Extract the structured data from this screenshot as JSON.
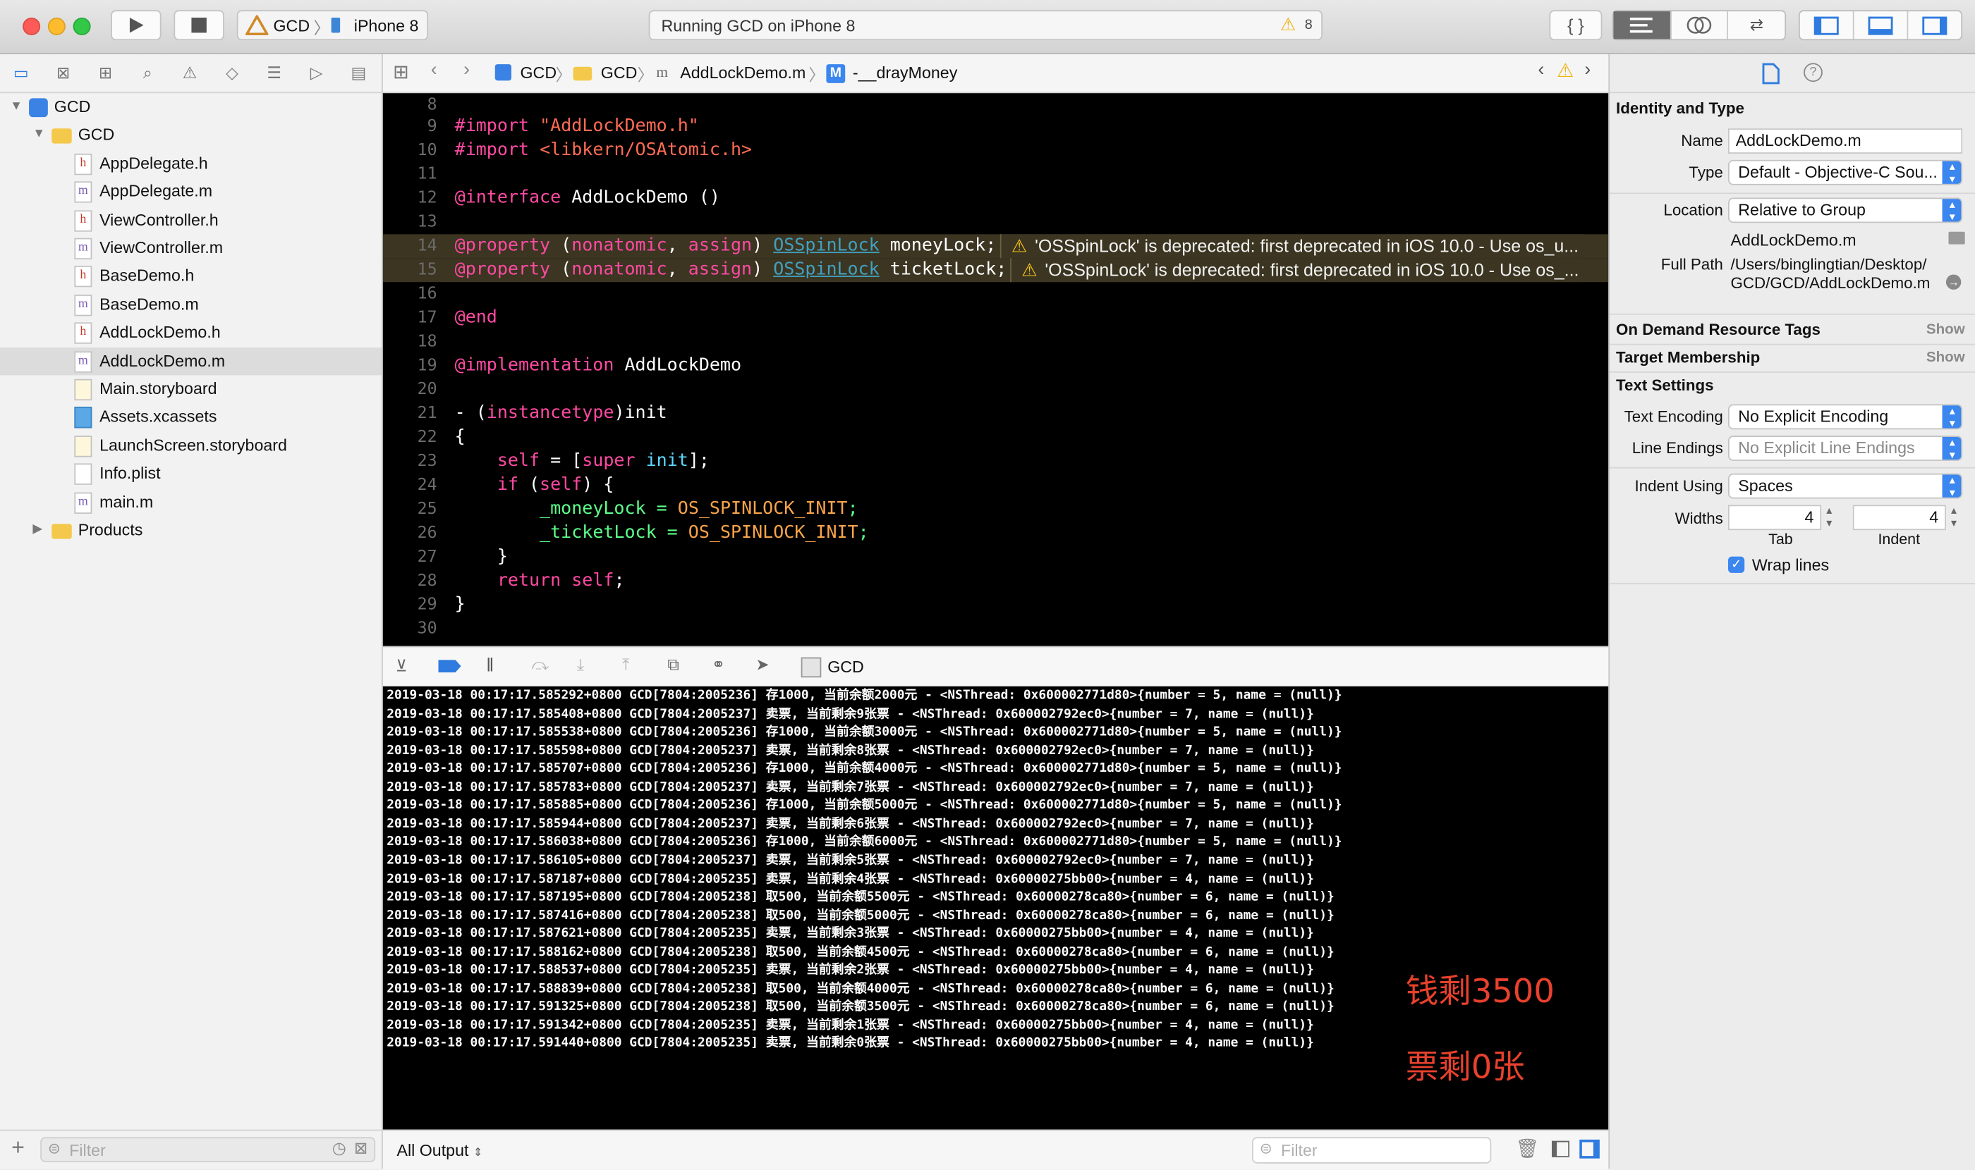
{
  "window": {
    "scheme_project": "GCD",
    "scheme_device": "iPhone 8",
    "status_text": "Running GCD on iPhone 8",
    "warning_count": "8"
  },
  "navigator": {
    "items": [
      {
        "label": "GCD",
        "kind": "project"
      },
      {
        "label": "GCD",
        "kind": "folder"
      },
      {
        "label": "AppDelegate.h",
        "kind": "h"
      },
      {
        "label": "AppDelegate.m",
        "kind": "m"
      },
      {
        "label": "ViewController.h",
        "kind": "h"
      },
      {
        "label": "ViewController.m",
        "kind": "m"
      },
      {
        "label": "BaseDemo.h",
        "kind": "h"
      },
      {
        "label": "BaseDemo.m",
        "kind": "m"
      },
      {
        "label": "AddLockDemo.h",
        "kind": "h"
      },
      {
        "label": "AddLockDemo.m",
        "kind": "m",
        "selected": true
      },
      {
        "label": "Main.storyboard",
        "kind": "storyboard"
      },
      {
        "label": "Assets.xcassets",
        "kind": "assets"
      },
      {
        "label": "LaunchScreen.storyboard",
        "kind": "storyboard"
      },
      {
        "label": "Info.plist",
        "kind": "plist"
      },
      {
        "label": "main.m",
        "kind": "m"
      },
      {
        "label": "Products",
        "kind": "folder"
      }
    ],
    "filter_placeholder": "Filter"
  },
  "jumpbar": {
    "crumbs": [
      "GCD",
      "GCD",
      "AddLockDemo.m",
      "-__drayMoney"
    ],
    "method_badge": "M"
  },
  "editor": {
    "lines": [
      {
        "n": "8",
        "t": ""
      },
      {
        "n": "9",
        "t": "#import \"AddLockDemo.h\""
      },
      {
        "n": "10",
        "t": "#import <libkern/OSAtomic.h>"
      },
      {
        "n": "11",
        "t": ""
      },
      {
        "n": "12",
        "t": "@interface AddLockDemo ()"
      },
      {
        "n": "13",
        "t": ""
      },
      {
        "n": "14",
        "t": "@property (nonatomic, assign) OSSpinLock moneyLock;"
      },
      {
        "n": "15",
        "t": "@property (nonatomic, assign) OSSpinLock ticketLock;"
      },
      {
        "n": "16",
        "t": ""
      },
      {
        "n": "17",
        "t": "@end"
      },
      {
        "n": "18",
        "t": ""
      },
      {
        "n": "19",
        "t": "@implementation AddLockDemo"
      },
      {
        "n": "20",
        "t": ""
      },
      {
        "n": "21",
        "t": "- (instancetype)init"
      },
      {
        "n": "22",
        "t": "{"
      },
      {
        "n": "23",
        "t": "    self = [super init];"
      },
      {
        "n": "24",
        "t": "    if (self) {"
      },
      {
        "n": "25",
        "t": "        _moneyLock = OS_SPINLOCK_INIT;"
      },
      {
        "n": "26",
        "t": "        _ticketLock = OS_SPINLOCK_INIT;"
      },
      {
        "n": "27",
        "t": "    }"
      },
      {
        "n": "28",
        "t": "    return self;"
      },
      {
        "n": "29",
        "t": "}"
      },
      {
        "n": "30",
        "t": ""
      }
    ],
    "warnings": [
      "'OSSpinLock' is deprecated: first deprecated in iOS 10.0 - Use os_u...",
      "'OSSpinLock' is deprecated: first deprecated in iOS 10.0 - Use os_..."
    ]
  },
  "debug": {
    "process_label": "GCD"
  },
  "console": {
    "lines": [
      "2019-03-18 00:17:17.585292+0800 GCD[7804:2005236] 存1000, 当前余额2000元 - <NSThread: 0x600002771d80>{number = 5, name = (null)}",
      "2019-03-18 00:17:17.585408+0800 GCD[7804:2005237] 卖票, 当前剩余9张票 - <NSThread: 0x600002792ec0>{number = 7, name = (null)}",
      "2019-03-18 00:17:17.585538+0800 GCD[7804:2005236] 存1000, 当前余额3000元 - <NSThread: 0x600002771d80>{number = 5, name = (null)}",
      "2019-03-18 00:17:17.585598+0800 GCD[7804:2005237] 卖票, 当前剩余8张票 - <NSThread: 0x600002792ec0>{number = 7, name = (null)}",
      "2019-03-18 00:17:17.585707+0800 GCD[7804:2005236] 存1000, 当前余额4000元 - <NSThread: 0x600002771d80>{number = 5, name = (null)}",
      "2019-03-18 00:17:17.585783+0800 GCD[7804:2005237] 卖票, 当前剩余7张票 - <NSThread: 0x600002792ec0>{number = 7, name = (null)}",
      "2019-03-18 00:17:17.585885+0800 GCD[7804:2005236] 存1000, 当前余额5000元 - <NSThread: 0x600002771d80>{number = 5, name = (null)}",
      "2019-03-18 00:17:17.585944+0800 GCD[7804:2005237] 卖票, 当前剩余6张票 - <NSThread: 0x600002792ec0>{number = 7, name = (null)}",
      "2019-03-18 00:17:17.586038+0800 GCD[7804:2005236] 存1000, 当前余额6000元 - <NSThread: 0x600002771d80>{number = 5, name = (null)}",
      "2019-03-18 00:17:17.586105+0800 GCD[7804:2005237] 卖票, 当前剩余5张票 - <NSThread: 0x600002792ec0>{number = 7, name = (null)}",
      "2019-03-18 00:17:17.587187+0800 GCD[7804:2005235] 卖票, 当前剩余4张票 - <NSThread: 0x60000275bb00>{number = 4, name = (null)}",
      "2019-03-18 00:17:17.587195+0800 GCD[7804:2005238] 取500, 当前余额5500元 - <NSThread: 0x60000278ca80>{number = 6, name = (null)}",
      "2019-03-18 00:17:17.587416+0800 GCD[7804:2005238] 取500, 当前余额5000元 - <NSThread: 0x60000278ca80>{number = 6, name = (null)}",
      "2019-03-18 00:17:17.587621+0800 GCD[7804:2005235] 卖票, 当前剩余3张票 - <NSThread: 0x60000275bb00>{number = 4, name = (null)}",
      "2019-03-18 00:17:17.588162+0800 GCD[7804:2005238] 取500, 当前余额4500元 - <NSThread: 0x60000278ca80>{number = 6, name = (null)}",
      "2019-03-18 00:17:17.588537+0800 GCD[7804:2005235] 卖票, 当前剩余2张票 - <NSThread: 0x60000275bb00>{number = 4, name = (null)}",
      "2019-03-18 00:17:17.588839+0800 GCD[7804:2005238] 取500, 当前余额4000元 - <NSThread: 0x60000278ca80>{number = 6, name = (null)}",
      "2019-03-18 00:17:17.591325+0800 GCD[7804:2005238] 取500, 当前余额3500元 - <NSThread: 0x60000278ca80>{number = 6, name = (null)}",
      "2019-03-18 00:17:17.591342+0800 GCD[7804:2005235] 卖票, 当前剩余1张票 - <NSThread: 0x60000275bb00>{number = 4, name = (null)}",
      "2019-03-18 00:17:17.591440+0800 GCD[7804:2005235] 卖票, 当前剩余0张票 - <NSThread: 0x60000275bb00>{number = 4, name = (null)}"
    ],
    "annotation_money": "钱剩3500",
    "annotation_tickets": "票剩0张",
    "output_selector": "All Output",
    "filter_placeholder": "Filter"
  },
  "inspector": {
    "identity_title": "Identity and Type",
    "name_label": "Name",
    "name_value": "AddLockDemo.m",
    "type_label": "Type",
    "type_value": "Default - Objective-C Sou...",
    "location_label": "Location",
    "location_value": "Relative to Group",
    "location_file": "AddLockDemo.m",
    "fullpath_label": "Full Path",
    "fullpath_line1": "/Users/binglingtian/Desktop/",
    "fullpath_line2": "GCD/GCD/AddLockDemo.m",
    "odr_title": "On Demand Resource Tags",
    "target_title": "Target Membership",
    "show_label": "Show",
    "text_title": "Text Settings",
    "encoding_label": "Text Encoding",
    "encoding_value": "No Explicit Encoding",
    "endings_label": "Line Endings",
    "endings_value": "No Explicit Line Endings",
    "indent_label": "Indent Using",
    "indent_value": "Spaces",
    "widths_label": "Widths",
    "tab_value": "4",
    "indent_width_value": "4",
    "tab_caption": "Tab",
    "indent_caption": "Indent",
    "wrap_label": "Wrap lines"
  },
  "colors": {
    "accent": "#3b86ef",
    "warning": "#f7c31a",
    "annotation": "#e8412d"
  }
}
